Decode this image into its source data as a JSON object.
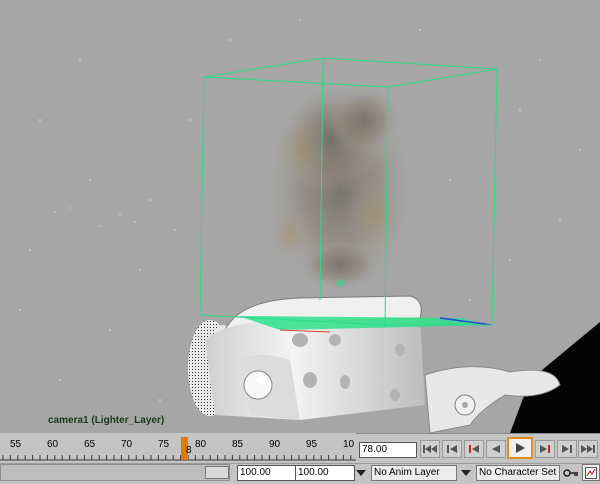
{
  "viewport": {
    "camera_label": "camera1 (Lighter_Layer)"
  },
  "timeline": {
    "tick_labels": [
      "55",
      "60",
      "65",
      "70",
      "75",
      "80",
      "85",
      "90",
      "95",
      "10"
    ],
    "current_frame_marker": "8",
    "current_time": "78.00",
    "marker_color": "#e07b00"
  },
  "playback": {
    "buttons": [
      {
        "name": "go-to-start-button",
        "icon": "skip-to-start-icon"
      },
      {
        "name": "step-back-key-button",
        "icon": "step-back-frame-icon"
      },
      {
        "name": "step-back-keyframe-button",
        "icon": "previous-keyframe-icon"
      },
      {
        "name": "play-backwards-button",
        "icon": "play-backwards-icon"
      },
      {
        "name": "play-forwards-button",
        "icon": "play-forwards-icon"
      },
      {
        "name": "next-keyframe-button",
        "icon": "next-keyframe-icon"
      },
      {
        "name": "step-forward-frame-button",
        "icon": "step-forward-frame-icon"
      },
      {
        "name": "go-to-end-button",
        "icon": "skip-to-end-icon"
      }
    ],
    "active_button": "play-forwards-button",
    "active_color": "#e58a1e"
  },
  "range": {
    "start_value": "100.00",
    "end_value": "100.00"
  },
  "layers": {
    "anim_layer": "No Anim Layer",
    "character_set": "No Character Set"
  }
}
